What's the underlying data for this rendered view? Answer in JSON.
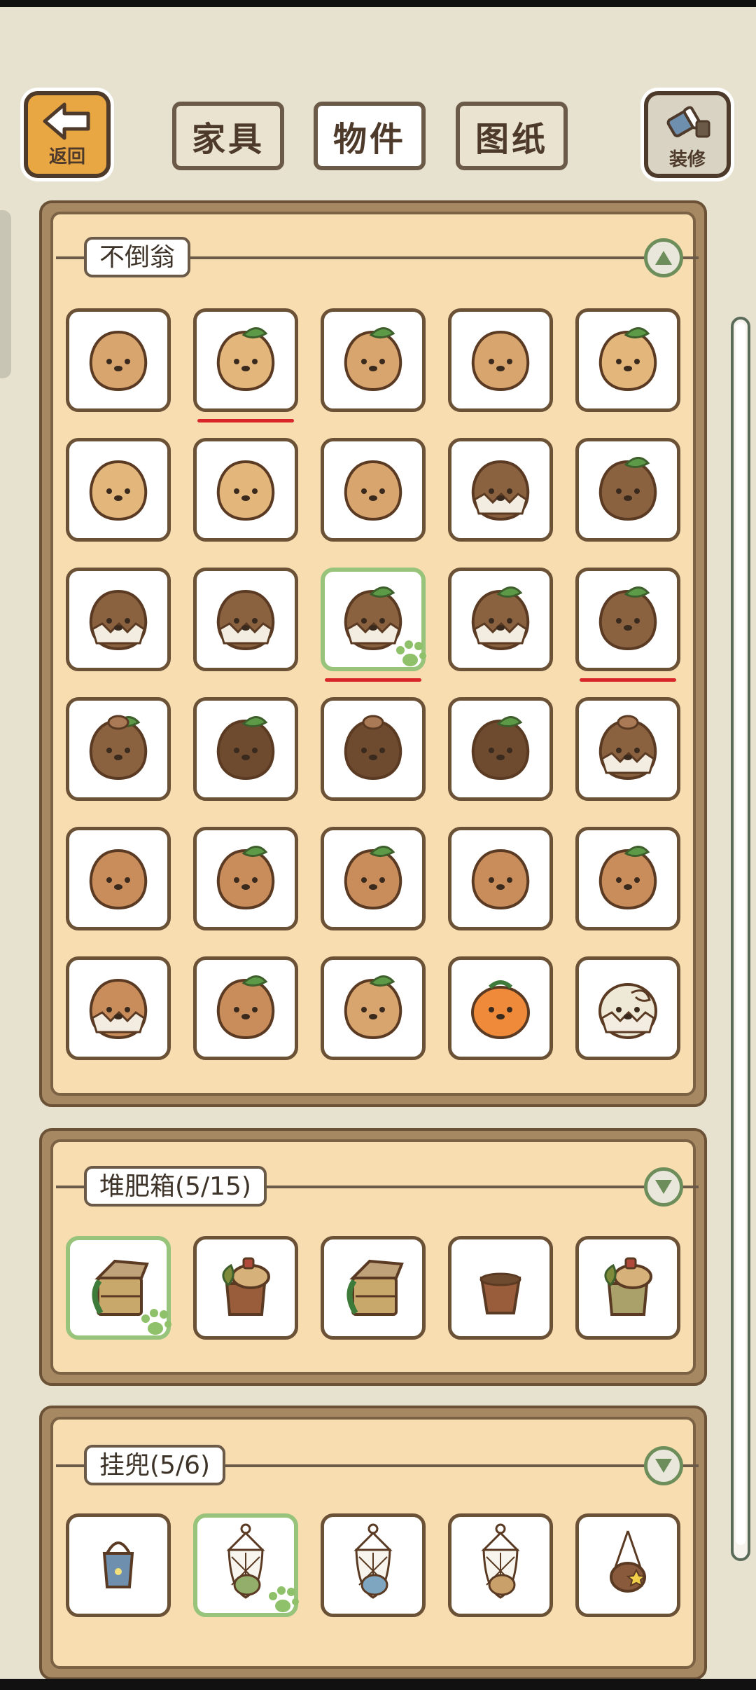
{
  "header": {
    "back_label": "返回",
    "decorate_label": "装修",
    "tabs": [
      {
        "label": "家具",
        "active": false
      },
      {
        "label": "物件",
        "active": true
      },
      {
        "label": "图纸",
        "active": false
      }
    ]
  },
  "sections": [
    {
      "title": "不倒翁",
      "expanded": true,
      "items": [
        {
          "icon": "plain-sloth-doll-icon",
          "color": "#d9a56e"
        },
        {
          "icon": "panda-sprout-doll-icon",
          "color": "#e3b77c"
        },
        {
          "icon": "glasses-leaf-doll-icon",
          "color": "#d9a56e"
        },
        {
          "icon": "bear-face-doll-icon",
          "color": "#d9a56e"
        },
        {
          "icon": "sleepy-leaf-doll-icon",
          "color": "#e3b77c"
        },
        {
          "icon": "laughing-doll-icon",
          "color": "#e3b77c"
        },
        {
          "icon": "smiling-doll-icon",
          "color": "#e3b77c"
        },
        {
          "icon": "spotted-doll-icon",
          "color": "#d9a56e"
        },
        {
          "icon": "chestnut-shell-doll-icon",
          "color": "#8b6240"
        },
        {
          "icon": "chestnut-leaf-doll-icon",
          "color": "#8b6240"
        },
        {
          "icon": "egg-shell-doll-icon",
          "color": "#8b6240"
        },
        {
          "icon": "blushing-egg-doll-icon",
          "color": "#8b6240"
        },
        {
          "icon": "sprout-egg-doll-icon",
          "color": "#8b6240"
        },
        {
          "icon": "cracked-sprout-doll-icon",
          "color": "#8b6240"
        },
        {
          "icon": "sprout-sloth-doll-icon",
          "color": "#8b6240"
        },
        {
          "icon": "mushroom-cap-doll-icon",
          "color": "#8b6240"
        },
        {
          "icon": "leaf-hood-doll-icon",
          "color": "#6e4a2f"
        },
        {
          "icon": "mushroom-arm-doll-icon",
          "color": "#6e4a2f"
        },
        {
          "icon": "berry-leaf-doll-icon",
          "color": "#6e4a2f"
        },
        {
          "icon": "mushroom-shell-doll-icon",
          "color": "#8b6240"
        },
        {
          "icon": "antenna-doll-icon",
          "color": "#c98d5c"
        },
        {
          "icon": "sprout-bird-doll-icon",
          "color": "#c98d5c"
        },
        {
          "icon": "angry-leaf-doll-icon",
          "color": "#c98d5c"
        },
        {
          "icon": "sloth-face-doll-icon",
          "color": "#c98d5c"
        },
        {
          "icon": "leaf-cap-doll-icon",
          "color": "#c98d5c"
        },
        {
          "icon": "cracked-monocle-doll-icon",
          "color": "#c98d5c"
        },
        {
          "icon": "onion-sprout-doll-icon",
          "color": "#c98d5c"
        },
        {
          "icon": "grumpy-leaf-doll-icon",
          "color": "#d9a56e"
        },
        {
          "icon": "pumpkin-doll-icon",
          "color": "#ee8a3a"
        },
        {
          "icon": "shell-bird-doll-icon",
          "color": "#eee8d6"
        }
      ]
    },
    {
      "title": "堆肥箱(5/15)",
      "expanded": false,
      "items": [
        {
          "icon": "vine-crate-compost-icon",
          "color": "#c9a86b"
        },
        {
          "icon": "leaf-pot-compost-icon",
          "color": "#9a5d3c"
        },
        {
          "icon": "vine-crate-compost-icon",
          "color": "#c9a86b"
        },
        {
          "icon": "clay-pot-compost-icon",
          "color": "#9a5d3c"
        },
        {
          "icon": "leaf-pot-compost-icon",
          "color": "#a9a06a"
        }
      ]
    },
    {
      "title": "挂兜(5/6)",
      "expanded": false,
      "items": [
        {
          "icon": "blue-bucket-bag-icon",
          "color": "#6f8fae"
        },
        {
          "icon": "green-net-bag-icon",
          "color": "#93ad6a"
        },
        {
          "icon": "blue-net-bag-icon",
          "color": "#7fa6c0"
        },
        {
          "icon": "tan-net-bag-icon",
          "color": "#c9a06a"
        },
        {
          "icon": "star-pouch-bag-icon",
          "color": "#8a5a3c"
        }
      ]
    }
  ]
}
